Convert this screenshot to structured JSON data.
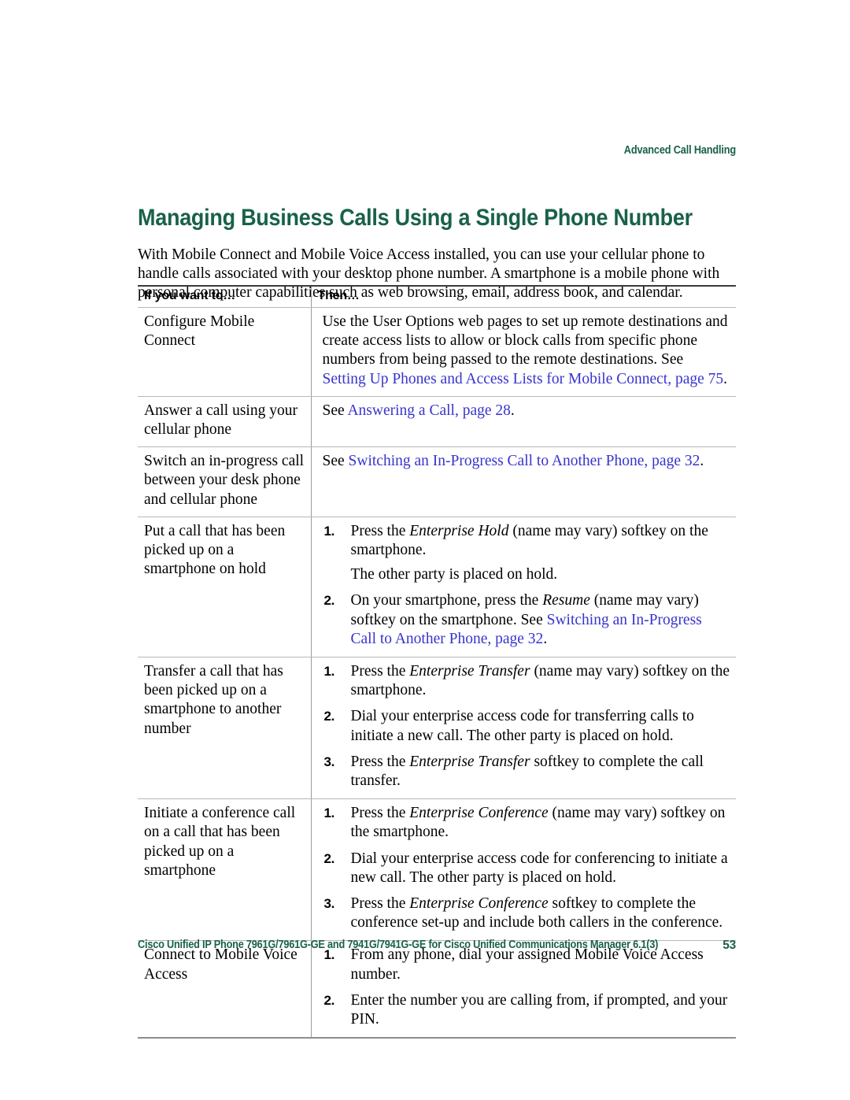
{
  "running_head": "Advanced Call Handling",
  "page_title": "Managing Business Calls Using a Single Phone Number",
  "intro": "With Mobile Connect and Mobile Voice Access installed, you can use your cellular phone to handle calls associated with your desktop phone number. A smartphone is a mobile phone with personal computer capabilities such as web browsing, email, address book, and calendar.",
  "colors": {
    "heading_green": "#19614A",
    "xref_blue": "#3734CC",
    "rule_dark": "#3b3b3b",
    "rule_light": "#b8b8b8"
  },
  "table": {
    "headers": {
      "col1": "If you want to…",
      "col2": "Then…"
    },
    "rows": [
      {
        "task": "Configure Mobile Connect",
        "paragraphs": [
          {
            "runs": [
              {
                "text": "Use the User Options web pages to set up remote destinations and create access lists to allow or block calls from specific phone numbers from being passed to the remote destinations. See ",
                "style": "plain"
              },
              {
                "text": "Setting Up Phones and Access Lists for Mobile Connect, page 75",
                "style": "xref"
              },
              {
                "text": ".",
                "style": "plain"
              }
            ]
          }
        ]
      },
      {
        "task": "Answer a call using your cellular phone",
        "paragraphs": [
          {
            "runs": [
              {
                "text": "See ",
                "style": "plain"
              },
              {
                "text": "Answering a Call, page 28",
                "style": "xref"
              },
              {
                "text": ".",
                "style": "plain"
              }
            ]
          }
        ]
      },
      {
        "task": "Switch an in-progress call between your desk phone and cellular phone",
        "paragraphs": [
          {
            "runs": [
              {
                "text": "See ",
                "style": "plain"
              },
              {
                "text": "Switching an In-Progress Call to Another Phone, page 32",
                "style": "xref"
              },
              {
                "text": ".",
                "style": "plain"
              }
            ]
          }
        ]
      },
      {
        "task": "Put a call that has been picked up on a smartphone on hold",
        "steps": [
          {
            "number": "1.",
            "runs": [
              {
                "text": "Press the ",
                "style": "plain"
              },
              {
                "text": "Enterprise Hold",
                "style": "italic"
              },
              {
                "text": " (name may vary) softkey on the smartphone.",
                "style": "plain"
              }
            ],
            "note": "The other party is placed on hold."
          },
          {
            "number": "2.",
            "runs": [
              {
                "text": "On your smartphone, press the ",
                "style": "plain"
              },
              {
                "text": "Resume",
                "style": "italic"
              },
              {
                "text": " (name may vary) softkey on the smartphone. See ",
                "style": "plain"
              },
              {
                "text": "Switching an In-Progress Call to Another Phone, page 32",
                "style": "xref"
              },
              {
                "text": ".",
                "style": "plain"
              }
            ]
          }
        ]
      },
      {
        "task": "Transfer a call that has been picked up on a smartphone to another number",
        "steps": [
          {
            "number": "1.",
            "runs": [
              {
                "text": "Press the ",
                "style": "plain"
              },
              {
                "text": "Enterprise Transfer",
                "style": "italic"
              },
              {
                "text": " (name may vary) softkey on the smartphone.",
                "style": "plain"
              }
            ]
          },
          {
            "number": "2.",
            "runs": [
              {
                "text": "Dial your enterprise access code for transferring calls to initiate a new call. The other party is placed on hold.",
                "style": "plain"
              }
            ]
          },
          {
            "number": "3.",
            "runs": [
              {
                "text": "Press the ",
                "style": "plain"
              },
              {
                "text": "Enterprise Transfer",
                "style": "italic"
              },
              {
                "text": " softkey to complete the call transfer.",
                "style": "plain"
              }
            ]
          }
        ]
      },
      {
        "task": "Initiate a conference call on a call that has been picked up on a smartphone",
        "steps": [
          {
            "number": "1.",
            "runs": [
              {
                "text": "Press the ",
                "style": "plain"
              },
              {
                "text": "Enterprise Conference",
                "style": "italic"
              },
              {
                "text": " (name may vary) softkey on the smartphone.",
                "style": "plain"
              }
            ]
          },
          {
            "number": "2.",
            "runs": [
              {
                "text": "Dial your enterprise access code for conferencing to initiate a new call. The other party is placed on hold.",
                "style": "plain"
              }
            ]
          },
          {
            "number": "3.",
            "runs": [
              {
                "text": "Press the ",
                "style": "plain"
              },
              {
                "text": "Enterprise Conference",
                "style": "italic"
              },
              {
                "text": " softkey to complete the conference set-up and include both callers in the conference.",
                "style": "plain"
              }
            ]
          }
        ]
      },
      {
        "task": "Connect to Mobile Voice Access",
        "steps": [
          {
            "number": "1.",
            "runs": [
              {
                "text": "From any phone, dial your assigned Mobile Voice Access number.",
                "style": "plain"
              }
            ]
          },
          {
            "number": "2.",
            "runs": [
              {
                "text": "Enter the number you are calling from, if prompted, and your PIN.",
                "style": "plain"
              }
            ]
          }
        ]
      }
    ]
  },
  "footer": {
    "text": "Cisco Unified IP Phone 7961G/7961G-GE and 7941G/7941G-GE for Cisco Unified Communications Manager 6.1(3)",
    "page_number": "53"
  }
}
